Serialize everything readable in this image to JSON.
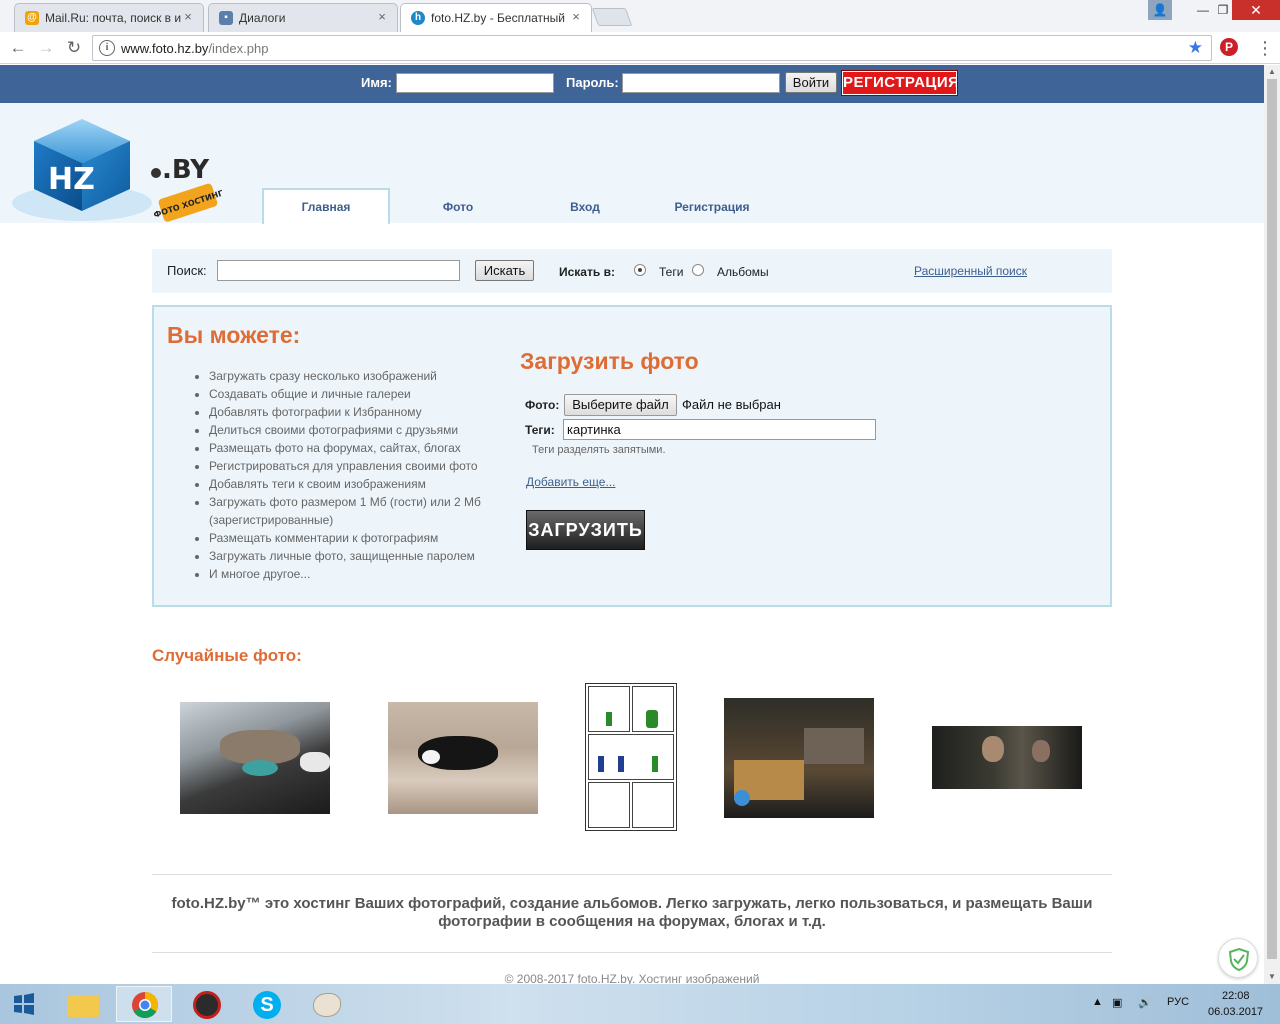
{
  "browser": {
    "tabs": [
      {
        "title": "Mail.Ru: почта, поиск в и",
        "active": false
      },
      {
        "title": "Диалоги",
        "active": false
      },
      {
        "title": "foto.HZ.by - Бесплатный",
        "active": true
      }
    ],
    "url_host": "www.foto.hz.by",
    "url_path": "/index.php"
  },
  "loginbar": {
    "name_label": "Имя:",
    "password_label": "Пароль:",
    "login_button": "Войти",
    "register_button": "РЕГИСТРАЦИЯ"
  },
  "logo": {
    "text": "HZ",
    "suffix": ".BY",
    "badge": "ФОТО ХОСТИНГ"
  },
  "nav": [
    {
      "label": "Главная",
      "active": true
    },
    {
      "label": "Фото",
      "active": false
    },
    {
      "label": "Вход",
      "active": false
    },
    {
      "label": "Регистрация",
      "active": false
    }
  ],
  "search": {
    "label": "Поиск:",
    "button": "Искать",
    "scope_label": "Искать в:",
    "option_tags": "Теги",
    "option_albums": "Альбомы",
    "selected": "Теги",
    "advanced_link": "Расширенный поиск"
  },
  "features": {
    "title": "Вы можете:",
    "items": [
      "Загружать сразу несколько изображений",
      "Создавать общие и личные галереи",
      "Добавлять фотографии к Избранному",
      "Делиться своими фотографиями с друзьями",
      "Размещать фото на форумах, сайтах, блогах",
      "Регистрироваться для управления своими фото",
      "Добавлять теги к своим изображениям",
      "Загружать фото размером 1 Мб (гости) или 2 Мб (зарегистрированные)",
      "Размещать комментарии к фотографиям",
      "Загружать личные фото, защищенные паролем",
      "И многое другое..."
    ]
  },
  "upload": {
    "title": "Загрузить фото",
    "photo_label": "Фото:",
    "choose_button": "Выберите файл",
    "no_file": "Файл не выбран",
    "tags_label": "Теги:",
    "tags_value": "картинка",
    "tags_hint": "Теги разделять запятыми.",
    "add_more": "Добавить еще...",
    "submit": "ЗАГРУЗИТЬ"
  },
  "random": {
    "title": "Случайные фото:"
  },
  "footer": {
    "about": "foto.HZ.by™ это хостинг Ваших фотографий, создание альбомов. Легко загружать, легко пользоваться, и размещать Ваши фотографии в сообщения на форумах, блогах и т.д.",
    "copyright": "© 2008-2017 foto.HZ.by. Хостинг изображений"
  },
  "taskbar": {
    "lang": "РУС",
    "time": "22:08",
    "date": "06.03.2017"
  },
  "colors": {
    "loginbar": "#3f6497",
    "accent_orange": "#df6c34",
    "link_blue": "#3d5f8e",
    "box_bg": "#edf5fb",
    "box_border": "#b8dce8",
    "register_red": "#e1181a"
  }
}
